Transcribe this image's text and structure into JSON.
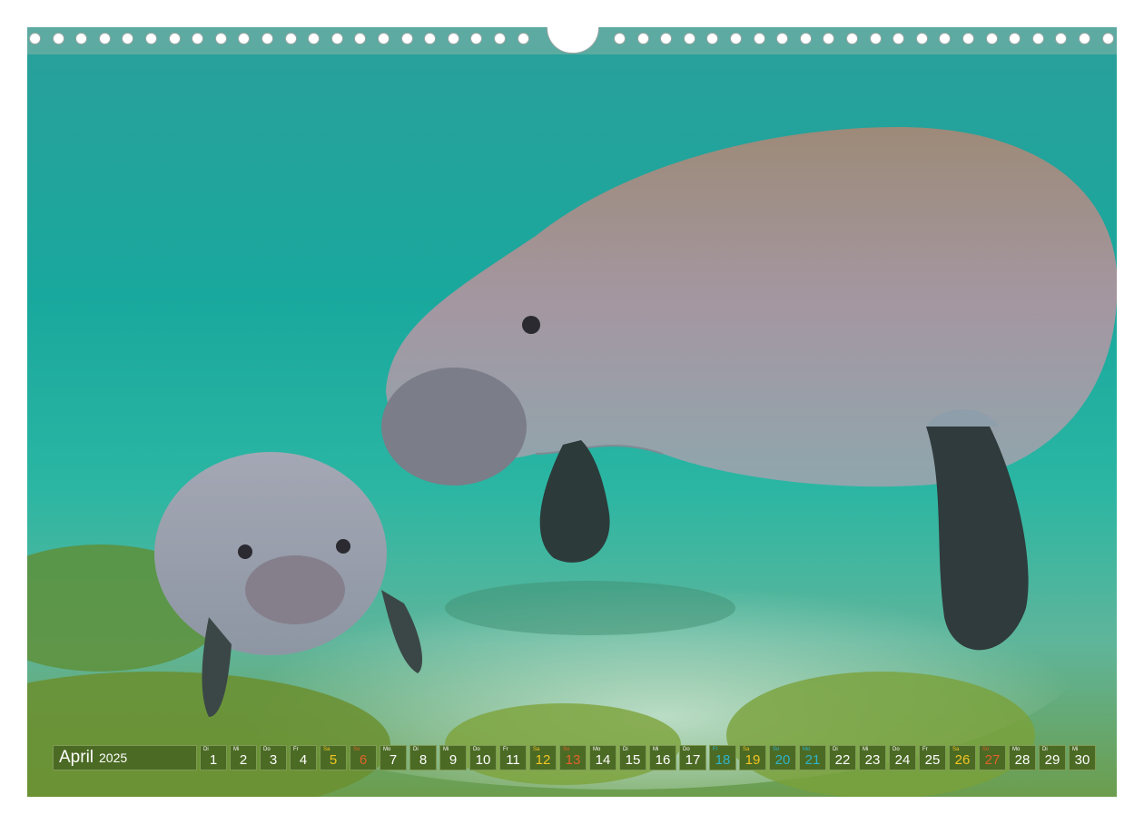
{
  "calendar": {
    "month": "April",
    "year": "2025",
    "days": [
      {
        "wd": "Di",
        "num": "1",
        "kind": "weekday"
      },
      {
        "wd": "Mi",
        "num": "2",
        "kind": "weekday"
      },
      {
        "wd": "Do",
        "num": "3",
        "kind": "weekday"
      },
      {
        "wd": "Fr",
        "num": "4",
        "kind": "weekday"
      },
      {
        "wd": "Sa",
        "num": "5",
        "kind": "sat"
      },
      {
        "wd": "So",
        "num": "6",
        "kind": "sun"
      },
      {
        "wd": "Mo",
        "num": "7",
        "kind": "weekday"
      },
      {
        "wd": "Di",
        "num": "8",
        "kind": "weekday"
      },
      {
        "wd": "Mi",
        "num": "9",
        "kind": "weekday"
      },
      {
        "wd": "Do",
        "num": "10",
        "kind": "weekday"
      },
      {
        "wd": "Fr",
        "num": "11",
        "kind": "weekday"
      },
      {
        "wd": "Sa",
        "num": "12",
        "kind": "sat"
      },
      {
        "wd": "So",
        "num": "13",
        "kind": "sun"
      },
      {
        "wd": "Mo",
        "num": "14",
        "kind": "weekday"
      },
      {
        "wd": "Di",
        "num": "15",
        "kind": "weekday"
      },
      {
        "wd": "Mi",
        "num": "16",
        "kind": "weekday"
      },
      {
        "wd": "Do",
        "num": "17",
        "kind": "weekday"
      },
      {
        "wd": "Fr",
        "num": "18",
        "kind": "holiday"
      },
      {
        "wd": "Sa",
        "num": "19",
        "kind": "sat"
      },
      {
        "wd": "So",
        "num": "20",
        "kind": "holiday"
      },
      {
        "wd": "Mo",
        "num": "21",
        "kind": "holiday"
      },
      {
        "wd": "Di",
        "num": "22",
        "kind": "weekday"
      },
      {
        "wd": "Mi",
        "num": "23",
        "kind": "weekday"
      },
      {
        "wd": "Do",
        "num": "24",
        "kind": "weekday"
      },
      {
        "wd": "Fr",
        "num": "25",
        "kind": "weekday"
      },
      {
        "wd": "Sa",
        "num": "26",
        "kind": "sat"
      },
      {
        "wd": "So",
        "num": "27",
        "kind": "sun"
      },
      {
        "wd": "Mo",
        "num": "28",
        "kind": "weekday"
      },
      {
        "wd": "Di",
        "num": "29",
        "kind": "weekday"
      },
      {
        "wd": "Mi",
        "num": "30",
        "kind": "weekday"
      }
    ]
  },
  "photo": {
    "subject": "manatee-mother-and-calf-icon"
  },
  "colors": {
    "strip_bg": "#4b6a24",
    "saturday": "#f2c522",
    "sunday": "#e0622a",
    "holiday": "#2fb3c9",
    "water": "#1aa89c"
  }
}
